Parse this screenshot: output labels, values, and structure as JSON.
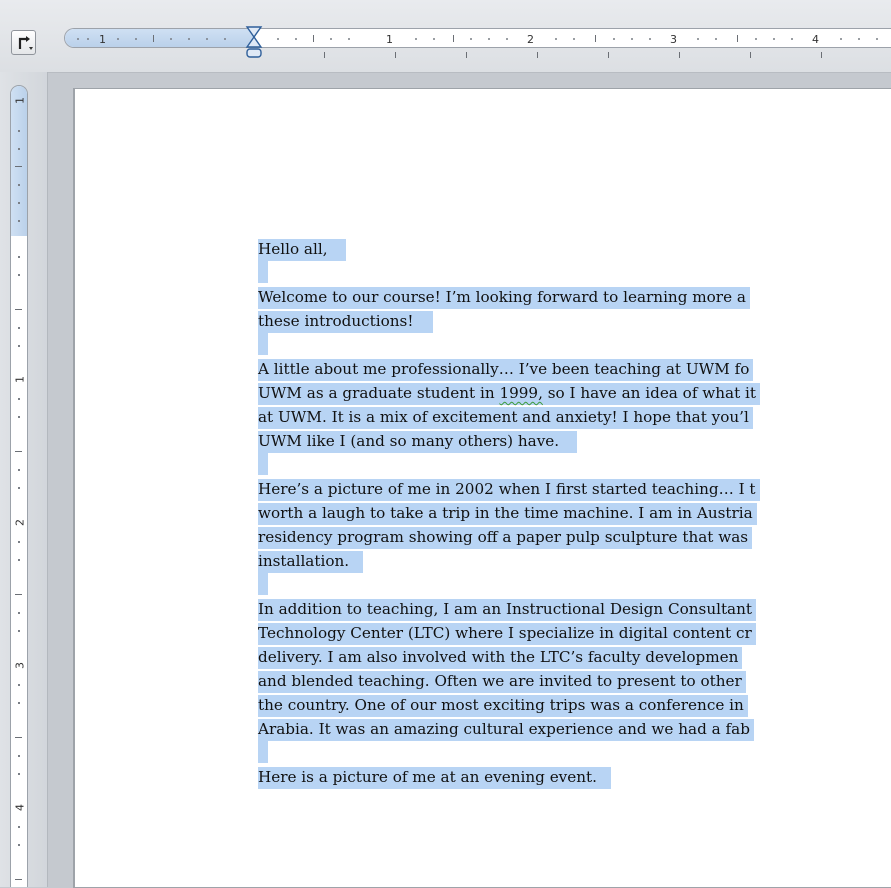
{
  "ruler": {
    "horizontal_numbers": [
      "1",
      "1",
      "2",
      "3",
      "4"
    ],
    "vertical_numbers": [
      "1",
      "1",
      "2",
      "3",
      "4"
    ]
  },
  "document": {
    "greeting": "Hello all,",
    "p1": [
      "Welcome to our course!  I’m looking forward to learning more a",
      "these introductions!"
    ],
    "p2": {
      "l1": "A little about me professionally…  I’ve been teaching at UWM fo",
      "l2_before": "UWM as a graduate student in ",
      "l2_flag": "1999,",
      "l2_after": " so I have an idea of what it",
      "l3": "at UWM.  It is a mix of excitement and anxiety!  I hope that you’l",
      "l4": "UWM like I (and so many others) have."
    },
    "p3": [
      "Here’s a picture of me in 2002 when I first started teaching… I t",
      "worth a laugh to take a trip in the time machine. I am in Austria",
      "residency program showing off a paper pulp sculpture that was",
      "installation."
    ],
    "p4": [
      "In addition to teaching, I am an Instructional Design Consultant",
      "Technology Center (LTC) where I specialize in digital content cr",
      "delivery.  I am also involved with the LTC’s faculty developmen",
      "and blended teaching.  Often we are invited to present to other",
      "the country.  One of our most exciting trips was a conference in",
      "Arabia.  It was an amazing cultural experience and we had a fab"
    ],
    "p5": "Here is a picture of me at an evening event."
  },
  "colors": {
    "selection": "#b8d4f4",
    "ruler_margin": "#c4d8ef",
    "gutter": "#c5c9cf",
    "page": "#ffffff",
    "spelling_squiggle": "#3a9a3a"
  },
  "icons": {
    "tab_selector": "left-tab-icon",
    "indent_marker": "indent-hourglass-icon"
  }
}
